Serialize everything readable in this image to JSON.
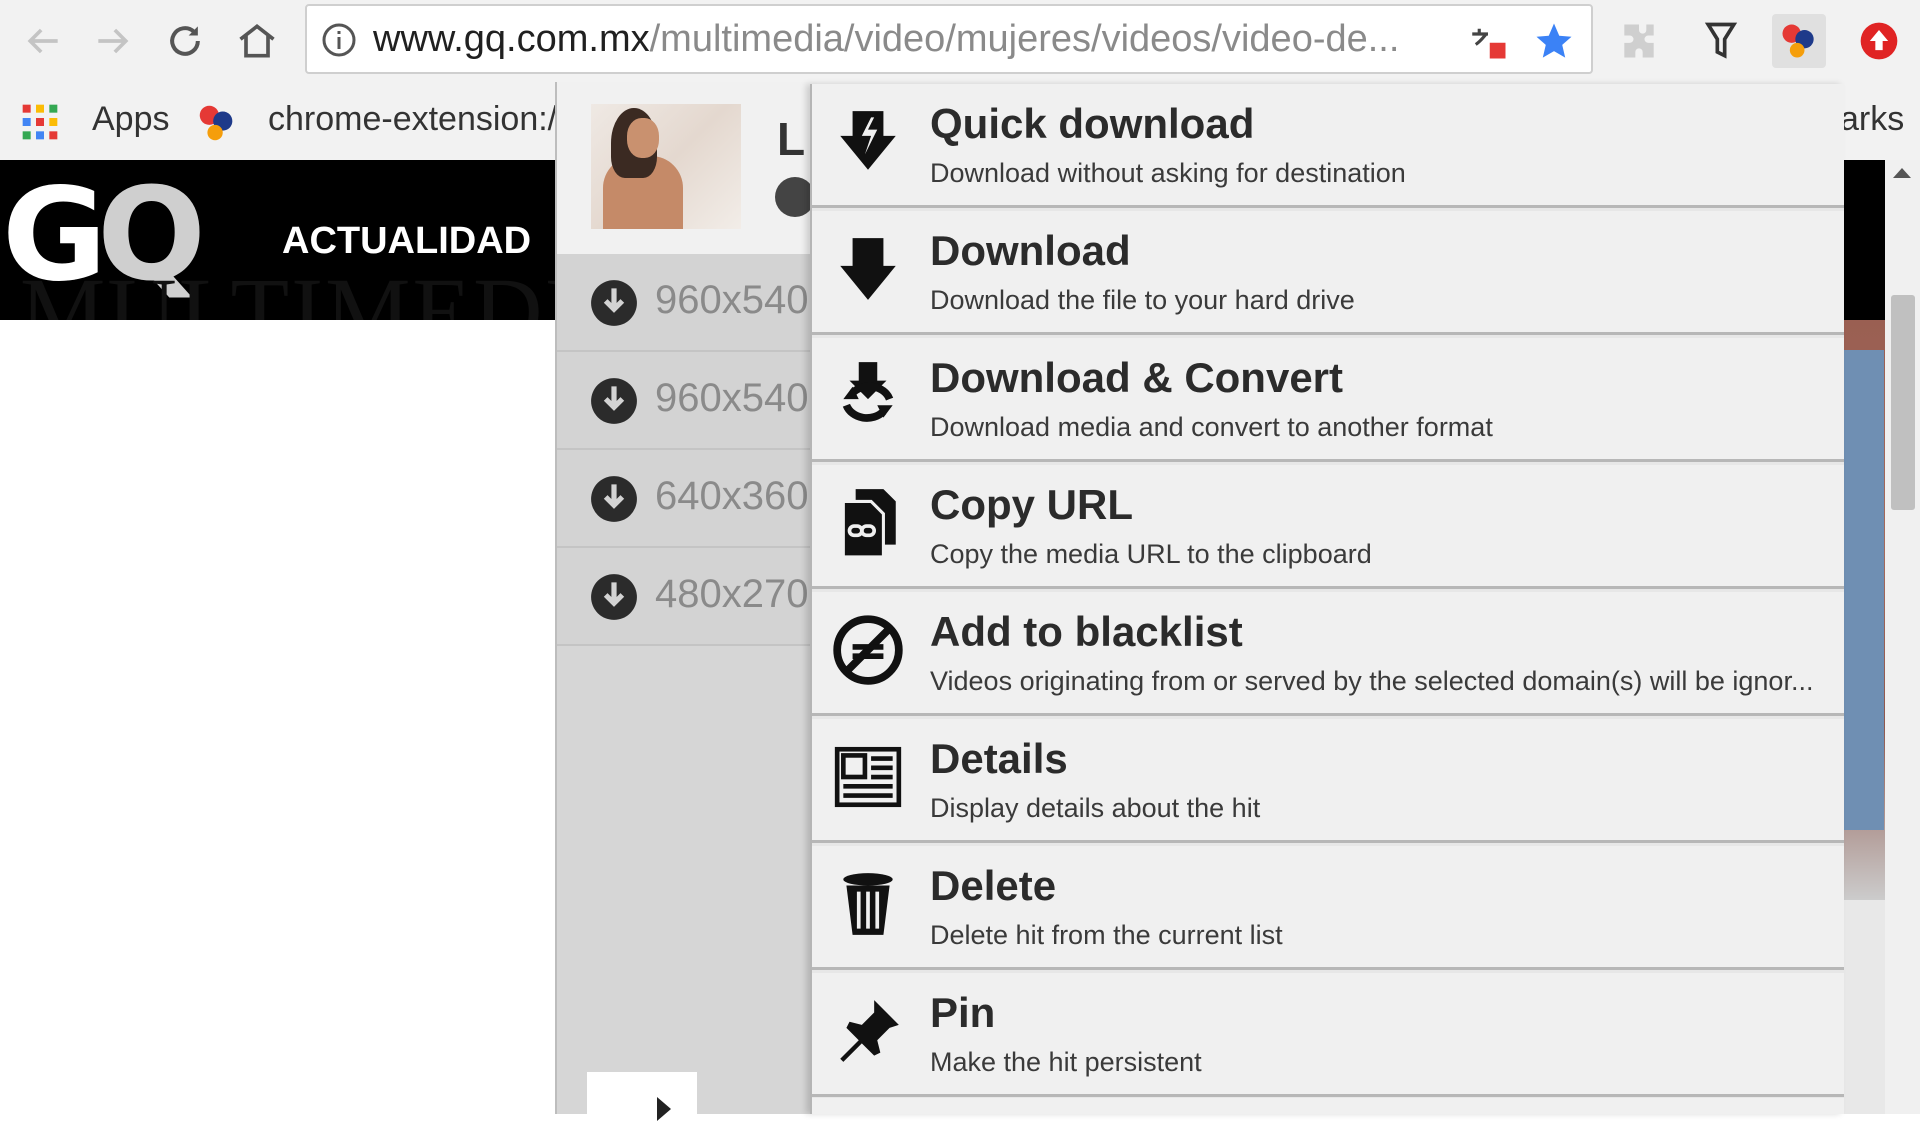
{
  "browser": {
    "url_host": "www.gq.com.mx",
    "url_path": "/multimedia/video/mujeres/videos/video-de...",
    "bookmarks": {
      "apps_label": "Apps",
      "ext_label": "chrome-extension:/",
      "right_label": "arks"
    }
  },
  "page": {
    "logo_g": "G",
    "logo_q": "Q",
    "nav_item": "ACTUALIDAD",
    "section_title": "MULTIMEDIA"
  },
  "popup": {
    "title_initial": "L",
    "resolutions": [
      "960x540",
      "960x540",
      "640x360",
      "480x270"
    ]
  },
  "menu": {
    "items": [
      {
        "icon": "quick-download-icon",
        "title": "Quick download",
        "desc": "Download without asking for destination"
      },
      {
        "icon": "download-icon",
        "title": "Download",
        "desc": "Download the file to your hard drive"
      },
      {
        "icon": "download-convert-icon",
        "title": "Download & Convert",
        "desc": "Download media and convert to another format"
      },
      {
        "icon": "copy-url-icon",
        "title": "Copy URL",
        "desc": "Copy the media URL to the clipboard"
      },
      {
        "icon": "blacklist-icon",
        "title": "Add to blacklist",
        "desc": "Videos originating from or served by the selected domain(s) will be ignor..."
      },
      {
        "icon": "details-icon",
        "title": "Details",
        "desc": "Display details about the hit"
      },
      {
        "icon": "trash-icon",
        "title": "Delete",
        "desc": "Delete hit from the current list"
      },
      {
        "icon": "pin-icon",
        "title": "Pin",
        "desc": "Make the hit persistent"
      }
    ]
  },
  "colors": {
    "menu_bg": "#f0f0f0",
    "menu_border": "#b7b7b7",
    "bookmark_star": "#3b82f6",
    "extension_red": "#e02424"
  }
}
